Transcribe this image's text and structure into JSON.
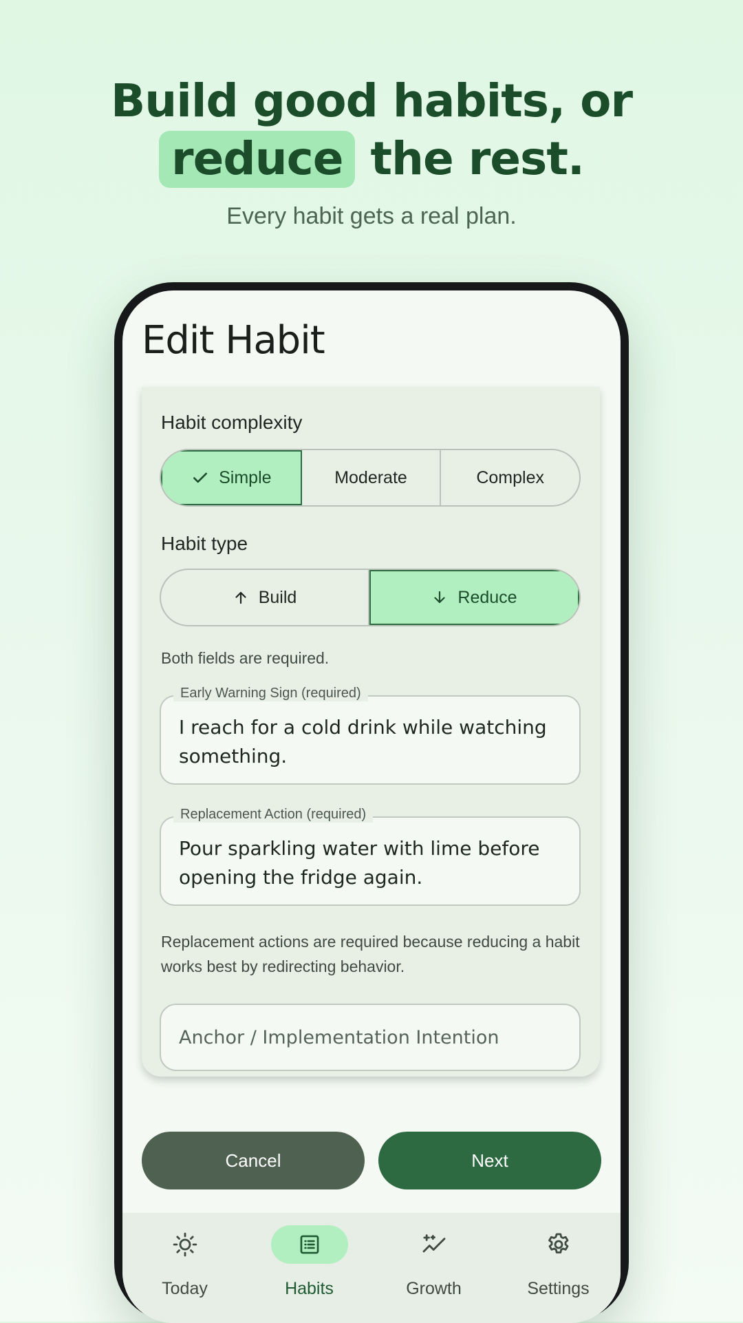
{
  "hero": {
    "headline_line1": "Build good habits, or",
    "headline_highlight": "reduce",
    "headline_rest": "the rest.",
    "subtitle": "Every habit gets a real plan."
  },
  "screen": {
    "title": "Edit Habit",
    "complexity": {
      "label": "Habit complexity",
      "options": [
        "Simple",
        "Moderate",
        "Complex"
      ],
      "selected": "Simple"
    },
    "type": {
      "label": "Habit type",
      "options": [
        "Build",
        "Reduce"
      ],
      "selected": "Reduce"
    },
    "required_note": "Both fields are required.",
    "warning_field": {
      "label": "Early Warning Sign (required)",
      "value": "I reach for a cold drink while watching something."
    },
    "replacement_field": {
      "label": "Replacement Action (required)",
      "value": "Pour sparkling water with lime before opening the fridge again."
    },
    "replacement_note": "Replacement actions are required because reducing a habit works best by redirecting behavior.",
    "anchor_placeholder": "Anchor / Implementation Intention",
    "cancel_label": "Cancel",
    "next_label": "Next"
  },
  "nav": {
    "items": [
      {
        "label": "Today",
        "icon": "sun-icon"
      },
      {
        "label": "Habits",
        "icon": "list-icon"
      },
      {
        "label": "Growth",
        "icon": "sparkle-chart-icon"
      },
      {
        "label": "Settings",
        "icon": "gear-icon"
      }
    ],
    "active": "Habits"
  },
  "colors": {
    "accent": "#2e6a41",
    "selected_bg": "#b2efc0",
    "headline": "#1b4d2b",
    "cancel_bg": "#4f6150"
  }
}
